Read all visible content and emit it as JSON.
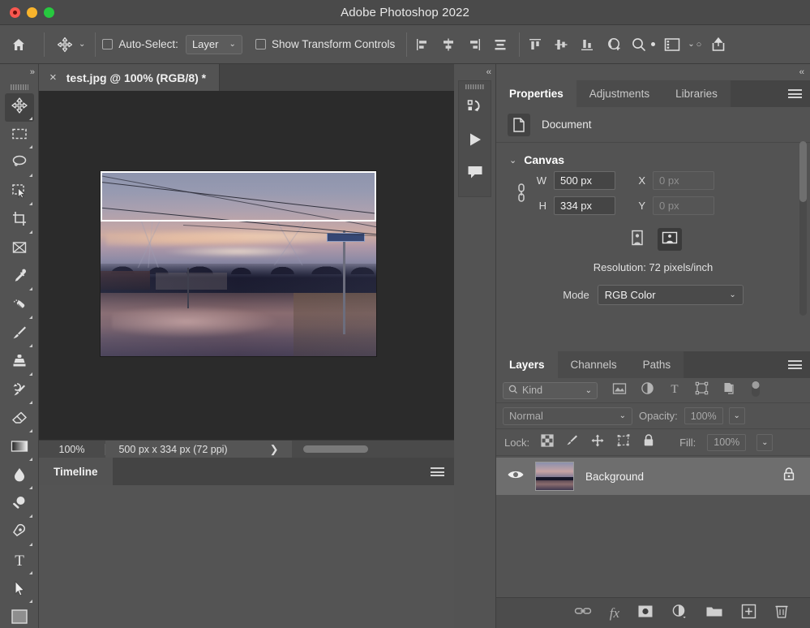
{
  "window": {
    "title": "Adobe Photoshop 2022",
    "traffic_lights": [
      "close",
      "minimize",
      "zoom"
    ]
  },
  "options_bar": {
    "home_icon": "home-icon",
    "tool_icon": "move-tool-icon",
    "tool_chevron": "⌄",
    "auto_select_checked": false,
    "auto_select_label": "Auto-Select:",
    "auto_select_value": "Layer",
    "show_transform_checked": false,
    "show_transform_label": "Show Transform Controls",
    "align_icons": [
      "align-left-edges-icon",
      "align-horizontal-centers-icon",
      "align-right-edges-icon",
      "distribute-horizontally-icon"
    ],
    "distribute_icons": [
      "align-top-edges-icon",
      "align-vertical-centers-icon",
      "align-bottom-edges-icon"
    ],
    "extra_icons": [
      "three-d-mode-icon",
      "search-icon",
      "workspace-icon",
      "workspace-chevron-icon",
      "share-icon"
    ]
  },
  "toolbar": {
    "collapse_glyph": "»",
    "tools": [
      {
        "name": "move-tool",
        "icon": "move-tool-icon",
        "active": true,
        "has_flyout": true
      },
      {
        "name": "rectangular-marquee-tool",
        "icon": "marquee-icon",
        "active": false,
        "has_flyout": true
      },
      {
        "name": "lasso-tool",
        "icon": "lasso-icon",
        "active": false,
        "has_flyout": true
      },
      {
        "name": "object-selection-tool",
        "icon": "object-selection-icon",
        "active": false,
        "has_flyout": true
      },
      {
        "name": "crop-tool",
        "icon": "crop-icon",
        "active": false,
        "has_flyout": true
      },
      {
        "name": "frame-tool",
        "icon": "frame-icon",
        "active": false,
        "has_flyout": false
      },
      {
        "name": "eyedropper-tool",
        "icon": "eyedropper-icon",
        "active": false,
        "has_flyout": true
      },
      {
        "name": "spot-healing-brush-tool",
        "icon": "healing-brush-icon",
        "active": false,
        "has_flyout": true
      },
      {
        "name": "brush-tool",
        "icon": "brush-icon",
        "active": false,
        "has_flyout": true
      },
      {
        "name": "clone-stamp-tool",
        "icon": "clone-stamp-icon",
        "active": false,
        "has_flyout": true
      },
      {
        "name": "history-brush-tool",
        "icon": "history-brush-icon",
        "active": false,
        "has_flyout": true
      },
      {
        "name": "eraser-tool",
        "icon": "eraser-icon",
        "active": false,
        "has_flyout": true
      },
      {
        "name": "gradient-tool",
        "icon": "gradient-icon",
        "active": false,
        "has_flyout": true
      },
      {
        "name": "blur-tool",
        "icon": "blur-drop-icon",
        "active": false,
        "has_flyout": true
      },
      {
        "name": "dodge-tool",
        "icon": "dodge-icon",
        "active": false,
        "has_flyout": true
      },
      {
        "name": "pen-tool",
        "icon": "pen-icon",
        "active": false,
        "has_flyout": true
      },
      {
        "name": "type-tool",
        "icon": "type-icon",
        "active": false,
        "has_flyout": true
      },
      {
        "name": "path-selection-tool",
        "icon": "path-selection-arrow-icon",
        "active": false,
        "has_flyout": true
      },
      {
        "name": "shape-tool",
        "icon": "rectangle-shape-icon",
        "active": false,
        "has_flyout": true
      }
    ]
  },
  "document": {
    "tab_label": "test.jpg @ 100% (RGB/8) *",
    "close_glyph": "×"
  },
  "status_bar": {
    "zoom": "100%",
    "dimensions": "500 px x 334 px (72 ppi)",
    "arrow_glyph": "❯"
  },
  "timeline": {
    "tab_label": "Timeline",
    "menu_icon": "panel-menu-icon"
  },
  "rail": {
    "collapse_glyph": "‹‹",
    "buttons": [
      {
        "name": "history-panel-button",
        "icon": "history-icon"
      },
      {
        "name": "actions-panel-button",
        "icon": "play-icon"
      },
      {
        "name": "comments-panel-button",
        "icon": "comment-bubble-icon"
      }
    ]
  },
  "dock": {
    "collapse_glyph": "‹‹"
  },
  "properties": {
    "tabs": [
      {
        "label": "Properties",
        "active": true
      },
      {
        "label": "Adjustments",
        "active": false
      },
      {
        "label": "Libraries",
        "active": false
      }
    ],
    "menu_icon": "panel-menu-icon",
    "doc_icon": "document-icon",
    "doc_label": "Document",
    "section_title": "Canvas",
    "twisty_glyph": "⌄",
    "link_icon": "link-constrain-icon",
    "w_label": "W",
    "w_value": "500 px",
    "h_label": "H",
    "h_value": "334 px",
    "x_label": "X",
    "x_value": "0 px",
    "y_label": "Y",
    "y_value": "0 px",
    "portrait_icon": "portrait-orientation-icon",
    "landscape_icon": "landscape-orientation-icon",
    "orientation_selected": "landscape",
    "resolution_text": "Resolution: 72 pixels/inch",
    "mode_label": "Mode",
    "mode_value": "RGB Color",
    "mode_chevron": "⌄"
  },
  "layers": {
    "tabs": [
      {
        "label": "Layers",
        "active": true
      },
      {
        "label": "Channels",
        "active": false
      },
      {
        "label": "Paths",
        "active": false
      }
    ],
    "menu_icon": "panel-menu-icon",
    "filter_kind_label": "Kind",
    "filter_search_icon": "search-icon",
    "filter_chevron": "⌄",
    "filter_icons": [
      "filter-pixel-layers-icon",
      "filter-adjustment-layers-icon",
      "filter-type-layers-icon",
      "filter-shape-layers-icon",
      "filter-smart-objects-icon",
      "filter-toggle-icon"
    ],
    "blend_mode": "Normal",
    "blend_chevron": "⌄",
    "opacity_label": "Opacity:",
    "opacity_value": "100%",
    "lock_label": "Lock:",
    "lock_icons": [
      "lock-transparent-pixels-icon",
      "lock-image-pixels-icon",
      "lock-position-icon",
      "lock-artboard-nesting-icon",
      "lock-all-icon"
    ],
    "fill_label": "Fill:",
    "fill_value": "100%",
    "rows": [
      {
        "visible": true,
        "eye_icon": "eye-icon",
        "name": "Background",
        "locked": true,
        "lock_icon": "lock-icon",
        "selected": true
      }
    ],
    "bottom_icons": [
      "link-layers-icon",
      "add-layer-style-icon",
      "add-layer-mask-icon",
      "new-fill-adjustment-layer-icon",
      "new-group-icon",
      "new-layer-icon",
      "delete-layer-icon"
    ],
    "bottom_fx_label": "fx"
  },
  "canvas": {
    "background_color": "#2b2b2b",
    "selection": {
      "present": true,
      "stroke": "#ffffff"
    },
    "image_description": "sunset-landscape-photo"
  },
  "colors": {
    "app_bg": "#535353",
    "titlebar": "#4a4a4a",
    "tab_inactive": "#4b4b4b",
    "panel_dark": "#444444",
    "canvas_bg": "#2b2b2b",
    "layer_selected": "#6e6e6e",
    "text_primary": "#f0f0f0",
    "text_muted": "#aeaeae"
  }
}
